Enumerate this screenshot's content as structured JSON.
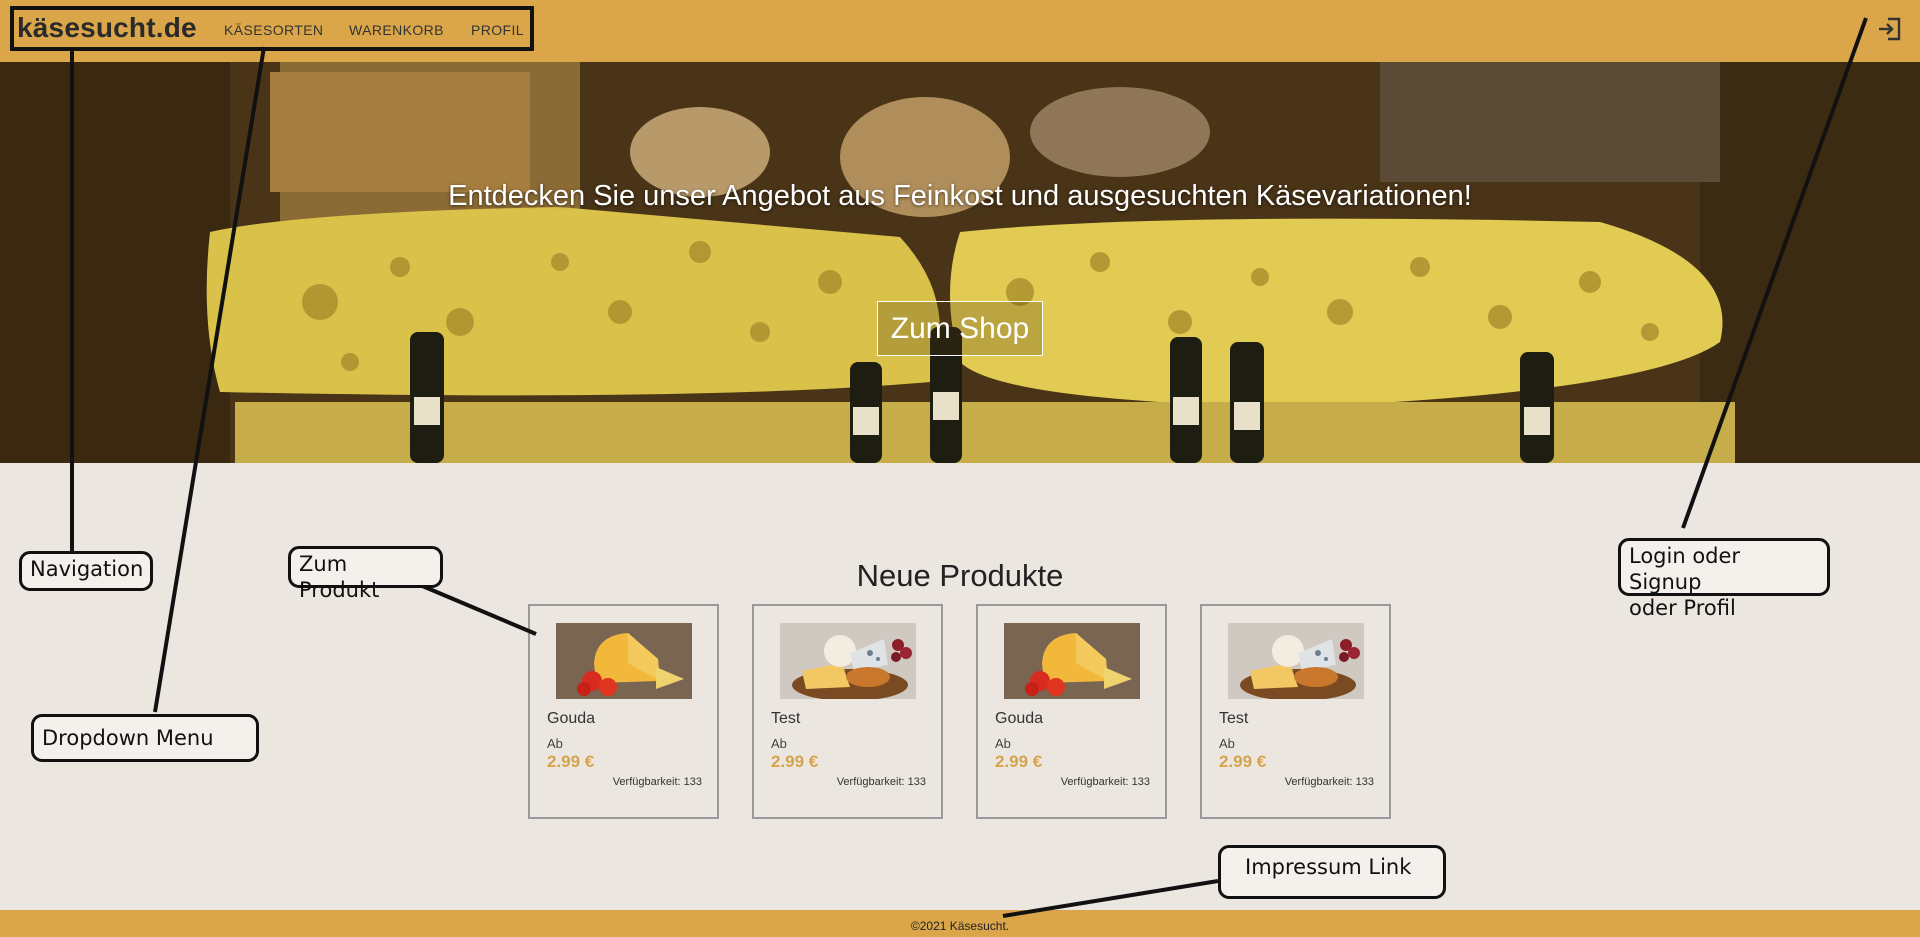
{
  "header": {
    "brand": "käsesucht.de",
    "nav": [
      "KÄSESORTEN",
      "WARENKORB",
      "PROFIL"
    ],
    "login_icon": "login-icon"
  },
  "hero": {
    "title": "Entdecken Sie unser Angebot aus Feinkost und ausgesuchten Käsevariationen!",
    "button": "Zum Shop"
  },
  "products": {
    "heading": "Neue Produkte",
    "items": [
      {
        "name": "Gouda",
        "ab": "Ab",
        "price": "2.99 €",
        "availability": "Verfügbarkeit: 133",
        "image": "gouda-wedge"
      },
      {
        "name": "Test",
        "ab": "Ab",
        "price": "2.99 €",
        "availability": "Verfügbarkeit: 133",
        "image": "cheese-platter"
      },
      {
        "name": "Gouda",
        "ab": "Ab",
        "price": "2.99 €",
        "availability": "Verfügbarkeit: 133",
        "image": "gouda-wedge"
      },
      {
        "name": "Test",
        "ab": "Ab",
        "price": "2.99 €",
        "availability": "Verfügbarkeit: 133",
        "image": "cheese-platter"
      }
    ]
  },
  "footer": {
    "text": "©2021 Käsesucht."
  },
  "annotations": {
    "navigation": "Navigation",
    "zum_produkt": "Zum Produkt",
    "dropdown": "Dropdown Menu",
    "login": "Login oder Signup\n  oder Profil",
    "impressum": "Impressum Link"
  },
  "colors": {
    "accent": "#dba64a",
    "price": "#d7a24a",
    "background": "#ebe7e0"
  }
}
